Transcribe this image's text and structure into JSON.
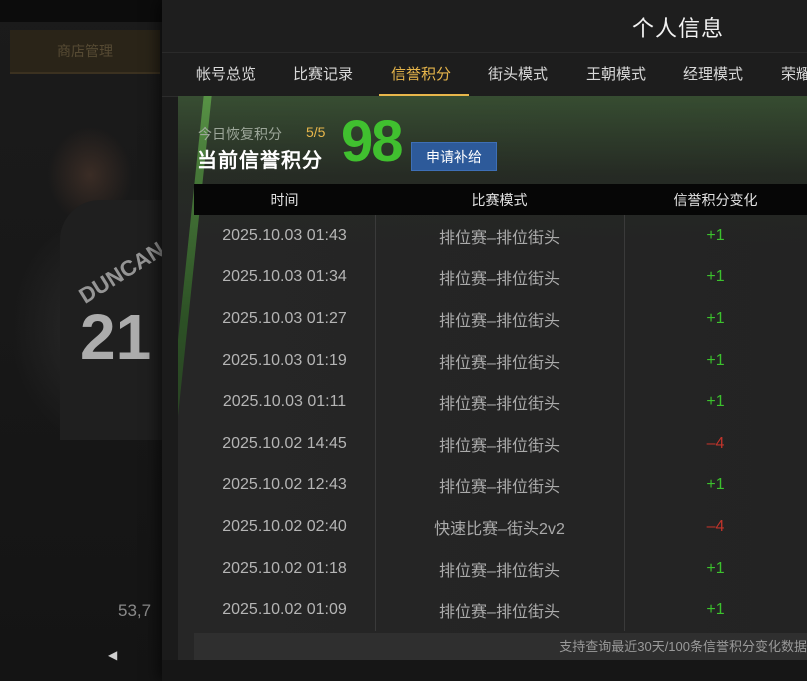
{
  "background": {
    "left_tab_label": "商店管理",
    "jersey_name": "DUNCAN",
    "jersey_number": "21",
    "stat_text": "53,7"
  },
  "dialog": {
    "title": "个人信息"
  },
  "tabs": [
    {
      "label": "帐号总览",
      "active": false
    },
    {
      "label": "比赛记录",
      "active": false
    },
    {
      "label": "信誉积分",
      "active": true
    },
    {
      "label": "街头模式",
      "active": false
    },
    {
      "label": "王朝模式",
      "active": false
    },
    {
      "label": "经理模式",
      "active": false
    },
    {
      "label": "荣耀",
      "active": false
    }
  ],
  "summary": {
    "recover_label": "今日恢复积分",
    "recover_value": "5/5",
    "current_label": "当前信誉积分",
    "score": "98",
    "apply_button": "申请补给"
  },
  "table": {
    "headers": [
      "时间",
      "比赛模式",
      "信誉积分变化"
    ],
    "rows": [
      {
        "time": "2025.10.03  01:43",
        "mode": "排位赛–排位街头",
        "change": "+1"
      },
      {
        "time": "2025.10.03  01:34",
        "mode": "排位赛–排位街头",
        "change": "+1"
      },
      {
        "time": "2025.10.03  01:27",
        "mode": "排位赛–排位街头",
        "change": "+1"
      },
      {
        "time": "2025.10.03  01:19",
        "mode": "排位赛–排位街头",
        "change": "+1"
      },
      {
        "time": "2025.10.03  01:11",
        "mode": "排位赛–排位街头",
        "change": "+1"
      },
      {
        "time": "2025.10.02  14:45",
        "mode": "排位赛–排位街头",
        "change": "–4"
      },
      {
        "time": "2025.10.02  12:43",
        "mode": "排位赛–排位街头",
        "change": "+1"
      },
      {
        "time": "2025.10.02  02:40",
        "mode": "快速比赛–街头2v2",
        "change": "–4"
      },
      {
        "time": "2025.10.02  01:18",
        "mode": "排位赛–排位街头",
        "change": "+1"
      },
      {
        "time": "2025.10.02  01:09",
        "mode": "排位赛–排位街头",
        "change": "+1"
      }
    ]
  },
  "footer_note": "支持查询最近30天/100条信誉积分变化数据",
  "colors": {
    "accent": "#e7b64b",
    "score_green": "#40c02f",
    "plus": "#3cc12d",
    "minus": "#c0342b",
    "button_blue": "#2d5a9a"
  }
}
